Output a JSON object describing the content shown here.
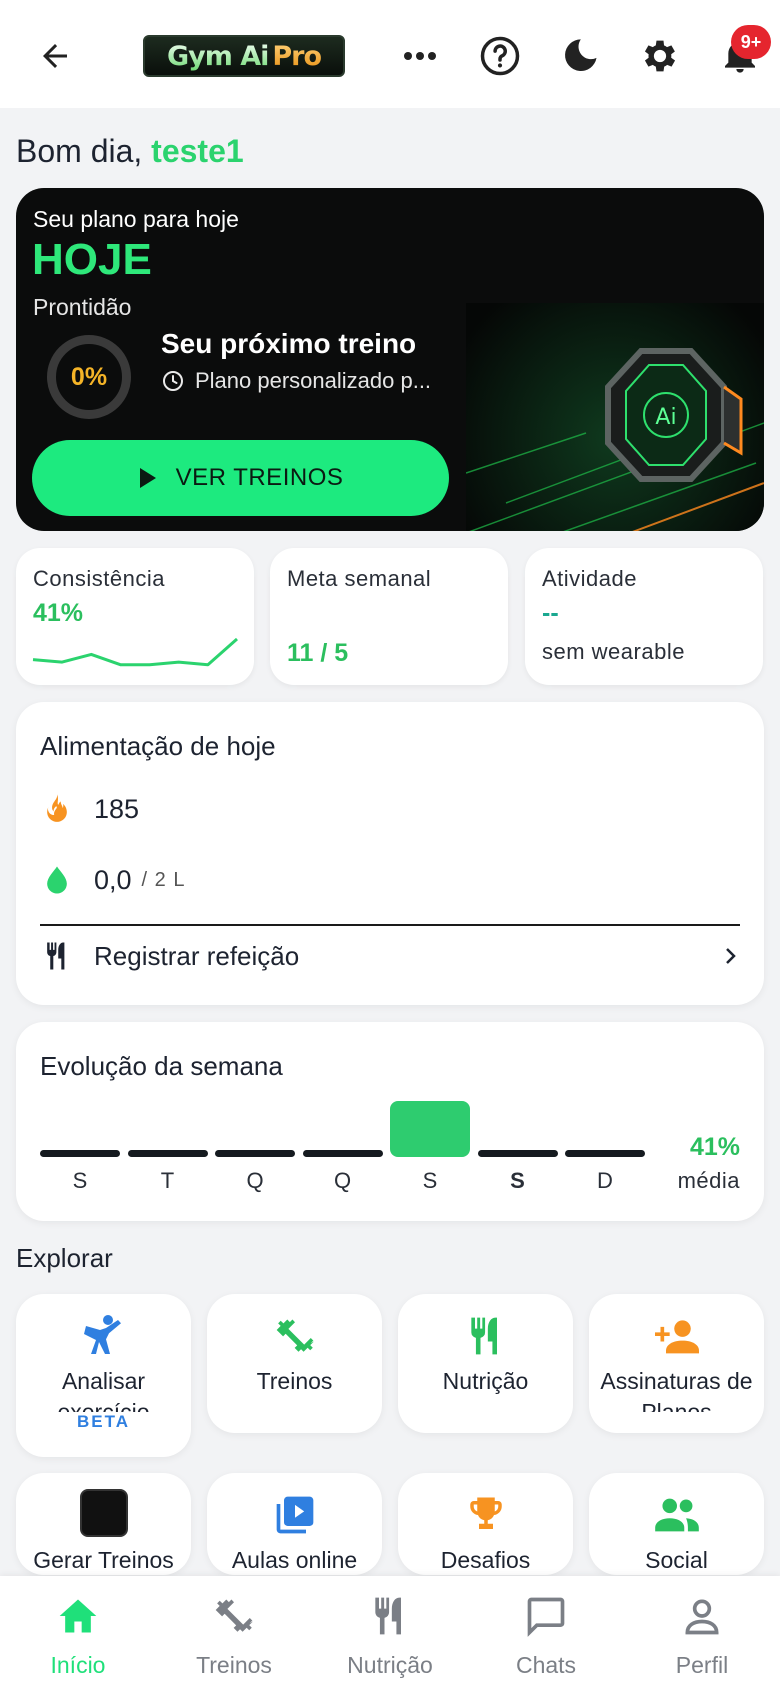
{
  "header": {
    "logo_text_a": "Gym Ai",
    "logo_text_b": "Pro",
    "notification_count": "9+",
    "icons": [
      "back-arrow-icon",
      "more-icon",
      "help-icon",
      "dark-mode-icon",
      "settings-icon",
      "bell-icon"
    ]
  },
  "greeting": {
    "prefix": "Bom dia,",
    "username": "teste1"
  },
  "hero": {
    "label": "Seu plano para hoje",
    "title": "HOJE",
    "readiness_label": "Prontidão",
    "readiness_value": "0%",
    "readiness_fraction": 0,
    "next_title": "Seu próximo treino",
    "next_sub": "Plano personalizado p...",
    "cta": "VER TREINOS"
  },
  "stats": [
    {
      "label": "Consistência",
      "value": "41%",
      "spark": [
        6,
        5,
        8,
        4,
        4,
        5,
        4,
        14
      ]
    },
    {
      "label": "Meta semanal",
      "value": "11 / 5"
    },
    {
      "label": "Atividade",
      "value": "--",
      "sub": "sem wearable"
    }
  ],
  "food": {
    "title": "Alimentação de hoje",
    "calories": "185",
    "water": "0,0",
    "water_unit": "/ 2 L",
    "log_meal": "Registrar refeição"
  },
  "week": {
    "title": "Evolução da semana",
    "days": [
      "S",
      "T",
      "Q",
      "Q",
      "S",
      "S",
      "D"
    ],
    "active_index": 4,
    "bold_index": 5,
    "avg_value": "41%",
    "avg_label": "média"
  },
  "explore": {
    "title": "Explorar",
    "tiles": [
      {
        "label": "Analisar exercício",
        "badge": "BETA"
      },
      {
        "label": "Treinos"
      },
      {
        "label": "Nutrição"
      },
      {
        "label": "Assinaturas de Planos"
      },
      {
        "label": "Gerar Treinos"
      },
      {
        "label": "Aulas online"
      },
      {
        "label": "Desafios"
      },
      {
        "label": "Social"
      }
    ]
  },
  "nav": [
    {
      "label": "Início",
      "active": true
    },
    {
      "label": "Treinos"
    },
    {
      "label": "Nutrição"
    },
    {
      "label": "Chats"
    },
    {
      "label": "Perfil"
    }
  ],
  "colors": {
    "accent": "#1fe07a",
    "accent_dark": "#2bbf5e",
    "warning": "#f5b427",
    "badge": "#e5252e"
  }
}
